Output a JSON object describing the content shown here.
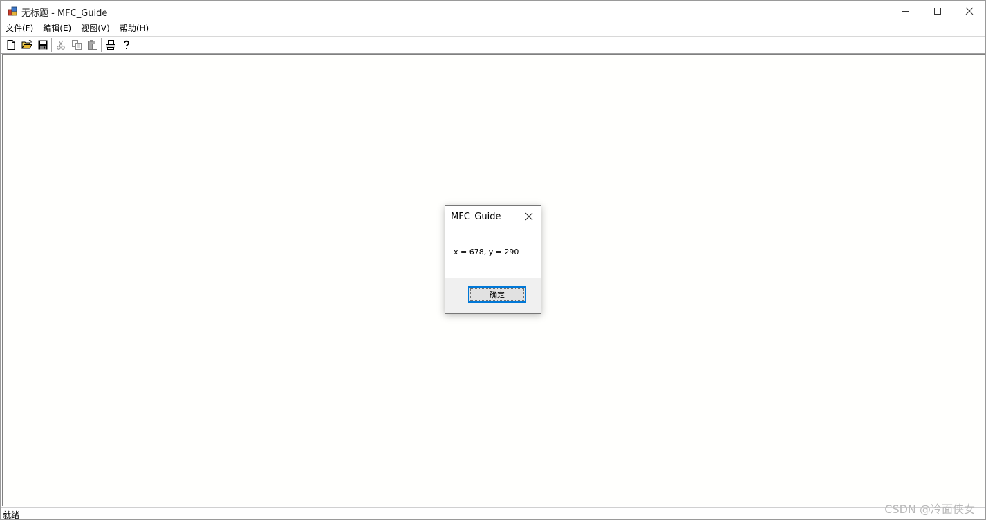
{
  "window": {
    "title": "无标题 - MFC_Guide",
    "caption_buttons": [
      "minimize-icon",
      "maximize-icon",
      "close-icon"
    ]
  },
  "menubar": {
    "items": [
      {
        "label": "文件(F)"
      },
      {
        "label": "编辑(E)"
      },
      {
        "label": "视图(V)"
      },
      {
        "label": "帮助(H)"
      }
    ]
  },
  "toolbar": {
    "buttons": [
      "new-document-icon",
      "open-folder-icon",
      "save-disk-icon",
      "cut-icon",
      "copy-icon",
      "paste-icon",
      "print-icon",
      "help-context-icon"
    ]
  },
  "status_bar": {
    "text": "就绪"
  },
  "dialog": {
    "title": "MFC_Guide",
    "message": "x = 678, y = 290",
    "ok_label": "确定"
  },
  "watermark": "CSDN @冷面侠女",
  "colors": {
    "accent": "#0078d7",
    "client_bg": "#fffffd",
    "dialog_footer": "#f0f0f0"
  }
}
